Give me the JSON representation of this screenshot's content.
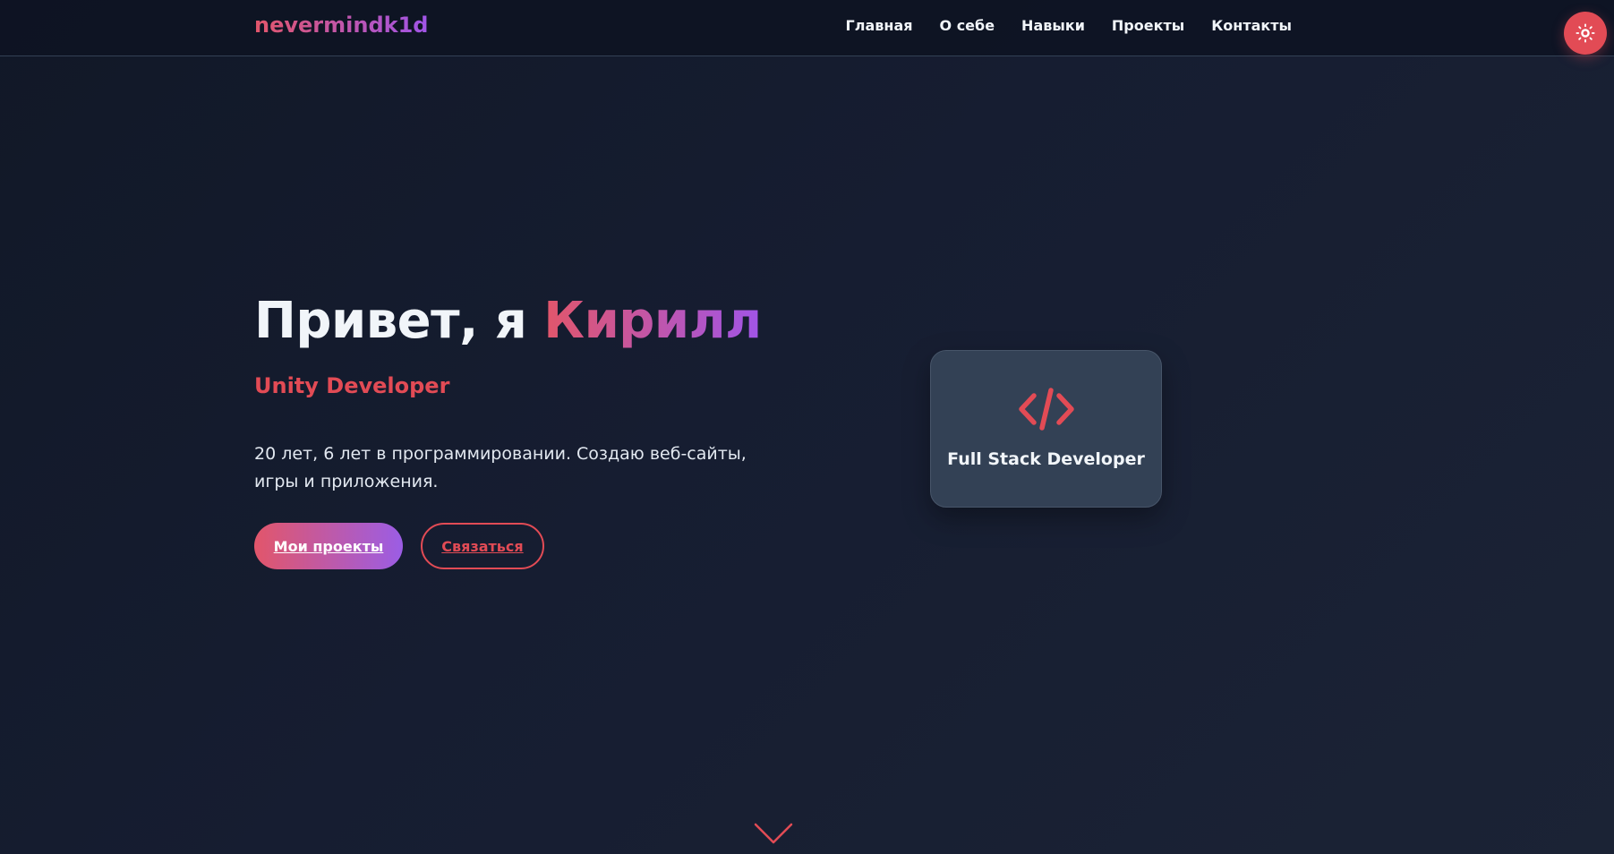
{
  "header": {
    "logo": "nevermindk1d",
    "nav": [
      "Главная",
      "О себе",
      "Навыки",
      "Проекты",
      "Контакты"
    ],
    "theme_toggle_icon": "sun-icon"
  },
  "hero": {
    "greeting": "Привет, я ",
    "name": "Кирилл",
    "subtitle": "Unity Developer",
    "description": "20 лет, 6 лет в программировании. Создаю веб-сайты, игры и приложения.",
    "primary_button": "Мои проекты",
    "secondary_button": "Связаться"
  },
  "card": {
    "icon": "code-icon",
    "label": "Full Stack Developer"
  },
  "scroll_indicator_icon": "chevron-down-icon",
  "colors": {
    "accent": "#e24b55",
    "gradient_start": "#e2566a",
    "gradient_end": "#a055e8",
    "background": "#161d31",
    "card": "#334155"
  }
}
